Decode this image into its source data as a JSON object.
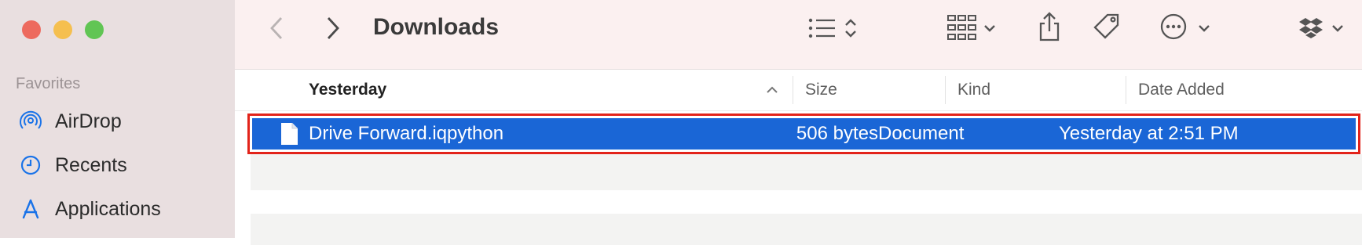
{
  "window": {
    "title": "Downloads"
  },
  "sidebar": {
    "section_label": "Favorites",
    "items": [
      {
        "label": "AirDrop",
        "icon": "airdrop-icon"
      },
      {
        "label": "Recents",
        "icon": "clock-icon"
      },
      {
        "label": "Applications",
        "icon": "applications-icon"
      }
    ]
  },
  "toolbar": {
    "icons": [
      "back-icon",
      "forward-icon",
      "list-view-icon",
      "sort-updown-icon",
      "grid-icon",
      "chevron-down-icon",
      "share-icon",
      "tag-icon",
      "more-icon",
      "dropbox-icon"
    ]
  },
  "table": {
    "columns": [
      {
        "label": "Yesterday"
      },
      {
        "label": "Size"
      },
      {
        "label": "Kind"
      },
      {
        "label": "Date Added"
      }
    ],
    "rows": [
      {
        "name": "Drive Forward.iqpython",
        "size": "506 bytes",
        "kind": "Document",
        "date_added": "Yesterday at 2:51 PM",
        "selected": true
      }
    ]
  },
  "colors": {
    "selection": "#1a66d6",
    "highlight_border": "#e2231a",
    "accent": "#1a73e8"
  }
}
